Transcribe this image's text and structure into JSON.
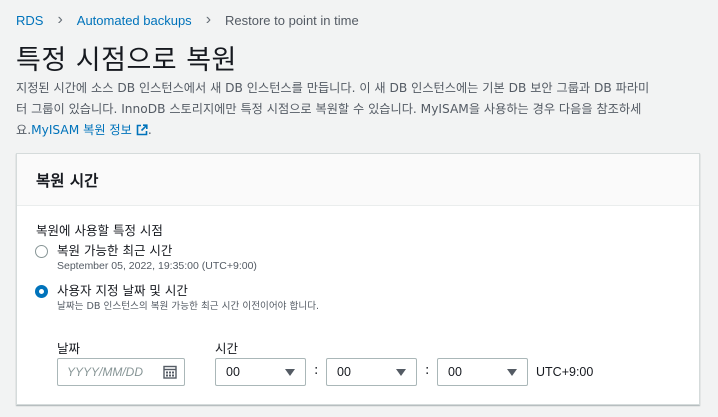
{
  "breadcrumb": [
    {
      "label": "RDS"
    },
    {
      "label": "Automated backups"
    },
    {
      "label": "Restore to point in time"
    }
  ],
  "page": {
    "title": "특정 시점으로 복원",
    "description_line1": "지정된 시간에 소스 DB 인스턴스에서 새 DB 인스턴스를 만듭니다. 이 새 DB 인스턴스에는 기본 DB 보안 그룹과 DB 파라미",
    "description_line2": "터 그룹이 있습니다. InnoDB 스토리지에만 특정 시점으로 복원할 수 있습니다. MyISAM을 사용하는 경우 다음을 참조하세",
    "description_line3_prefix": "요.",
    "link_label": "MyISAM 복원 정보",
    "description_suffix": "."
  },
  "panel": {
    "header": "복원 시간",
    "field_label": "복원에 사용할 특정 시점",
    "options": [
      {
        "label": "복원 가능한 최근 시간",
        "description": "September 05, 2022, 19:35:00 (UTC+9:00)",
        "selected": false
      },
      {
        "label": "사용자 지정 날짜 및 시간",
        "description": "날짜는 DB 인스턴스의 복원 가능한 최근 시간 이전이어야 합니다.",
        "selected": true
      }
    ],
    "date_label": "날짜",
    "date_placeholder": "YYYY/MM/DD",
    "time_label": "시간",
    "hour": "00",
    "minute": "00",
    "second": "00",
    "colon": ":",
    "timezone": "UTC+9:00"
  },
  "colors": {
    "link": "#0073bb",
    "background": "#f2f3f3",
    "selected_radio": "#0073bb"
  },
  "icons": {
    "breadcrumb_separator": "chevron-right-icon",
    "external_link": "external-link-icon",
    "date_picker": "calendar-icon",
    "select_caret": "caret-down-icon"
  }
}
